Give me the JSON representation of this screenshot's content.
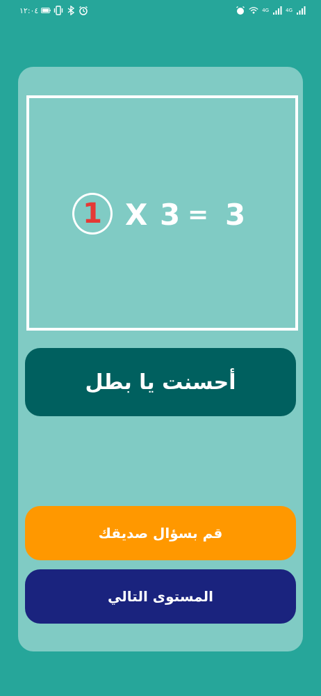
{
  "status_bar": {
    "time": "١٢:٠٤",
    "icons": [
      "battery-icon",
      "vibrate-icon",
      "bluetooth-icon",
      "alarm-icon",
      "wifi-icon",
      "signal-icon"
    ],
    "network_label_1": "4G",
    "network_label_2": "4G"
  },
  "equation": {
    "answer": "1",
    "operator": "X",
    "operand": "3",
    "equals": "=",
    "result": "3"
  },
  "feedback": {
    "message": "أحسنت يا بطل"
  },
  "buttons": {
    "ask_friend": "قم بسؤال صديقك",
    "next_level": "المستوى التالي"
  },
  "colors": {
    "background": "#26a69a",
    "card": "#80cbc4",
    "feedback_banner": "#00605f",
    "ask_friend_button": "#ff9800",
    "next_level_button": "#1a237e",
    "answer_digit": "#e53935"
  }
}
